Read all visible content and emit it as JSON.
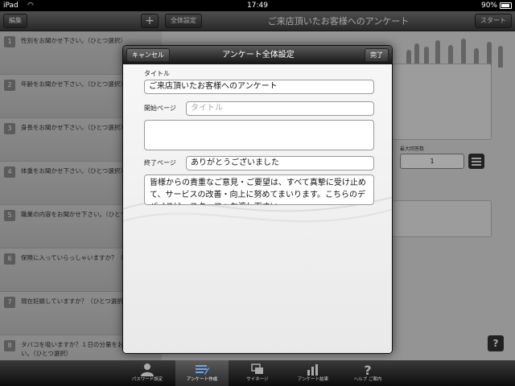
{
  "status_bar": {
    "carrier": "iPad",
    "time": "17:49",
    "battery": "90%"
  },
  "left_panel": {
    "edit_label": "編集",
    "add_label": "+",
    "questions": [
      {
        "number": "1",
        "text": "性別をお聞かせ下さい。（ひとつ選択）"
      },
      {
        "number": "2",
        "text": "年齢をお聞かせ下さい。（ひとつ選択）"
      },
      {
        "number": "3",
        "text": "身長をお聞かせ下さい。（ひとつ選択）"
      },
      {
        "number": "4",
        "text": "体重をお聞かせ下さい。（ひとつ選択）"
      },
      {
        "number": "5",
        "text": "職業の内容をお聞かせ下さい。（ひとつ選択）"
      },
      {
        "number": "6",
        "text": "保険に入っていらっしゃいますか？（ひとつ選択）"
      },
      {
        "number": "7",
        "text": "現在妊娠していますか？（ひとつ選択）"
      },
      {
        "number": "8",
        "text": "タバコを吸いますか？１日の分量をお聞かせ下さい。（ひとつ選択）"
      }
    ]
  },
  "right_panel": {
    "settings_label": "全体設定",
    "title": "ご来店頂いたお客様へのアンケート",
    "start_label": "スタート",
    "max_answers_label": "最大回答数",
    "max_answers_value": "1",
    "help_label": "?"
  },
  "modal": {
    "title": "アンケート全体設定",
    "cancel_label": "キャンセル",
    "done_label": "完了",
    "title_label": "タイトル",
    "title_value": "ご来店頂いたお客様へのアンケート",
    "start_page_label": "開始ページ",
    "start_page_placeholder": "タイトル",
    "start_page_body": "",
    "end_page_label": "終了ページ",
    "end_page_value": "ありがとうございました",
    "end_page_body": "皆様からの貴重なご意見・ご要望は、すべて真摯に受け止めて、サービスの改善・向上に努めてまいります。こちらのデバイスは、スタッフへお渡し下さい。"
  },
  "tab_bar": {
    "tabs": [
      {
        "label": "パスワード設定",
        "icon": "person-icon"
      },
      {
        "label": "アンケート作成",
        "icon": "edit-icon"
      },
      {
        "label": "サイネージ",
        "icon": "signage-icon"
      },
      {
        "label": "アンケート結果",
        "icon": "chart-icon"
      },
      {
        "label": "ヘルプ ご案内",
        "icon": "question-icon"
      }
    ],
    "active_index": 1
  },
  "colors": {
    "toolbar_dark": "#3e3e3e",
    "panel_gray": "#c9c9c9",
    "modal_bg": "#f3f3f3",
    "accent_blue": "#4a6fb0"
  }
}
